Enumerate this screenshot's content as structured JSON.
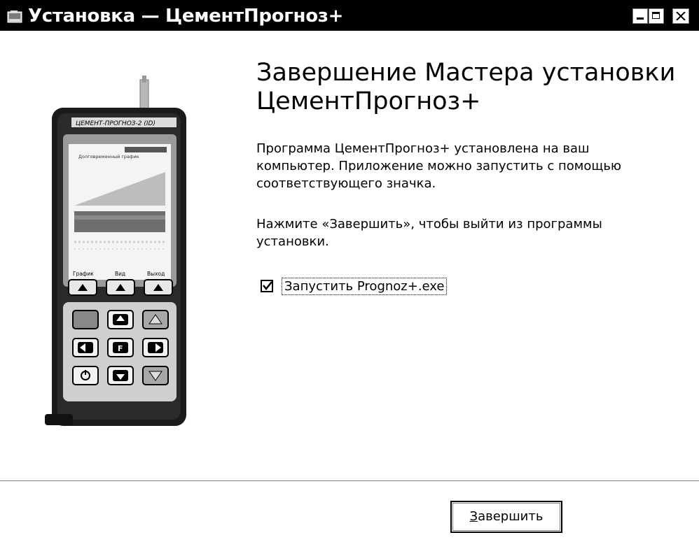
{
  "window": {
    "title": "Установка — ЦементПрогноз+",
    "icon": "installer-icon",
    "controls": [
      "minimize-icon",
      "maximize-icon",
      "close-icon"
    ]
  },
  "device": {
    "brand": "ЦЕМЕНТ-ПРОГНОЗ-2 (ID)",
    "screen_title": "Долговременный график",
    "softkeys": [
      "График",
      "Вид",
      "Выход"
    ]
  },
  "main": {
    "heading": "Завершение Мастера установки ЦементПрогноз+",
    "paragraph1": "Программа ЦементПрогноз+ установлена на ваш компьютер. Приложение можно запустить с помощью соответствующего значка.",
    "paragraph2": "Нажмите «Завершить», чтобы выйти из программы установки.",
    "run_checkbox": {
      "label": "Запустить Prognoz+.exe",
      "checked": true
    }
  },
  "footer": {
    "finish_button": {
      "accel": "З",
      "rest": "авершить"
    }
  }
}
